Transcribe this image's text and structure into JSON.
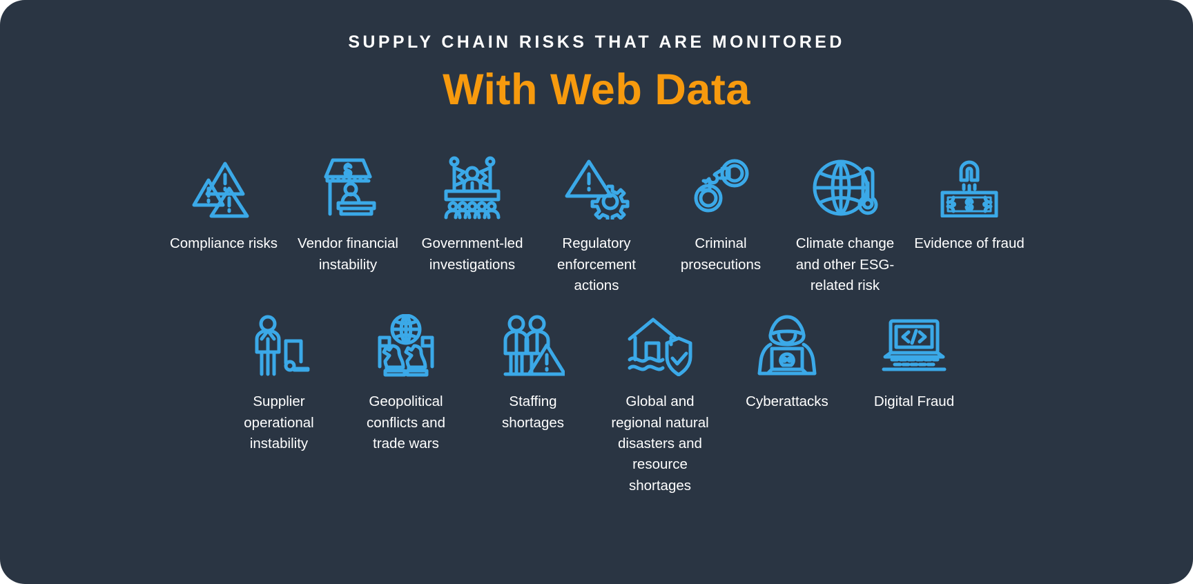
{
  "theme": {
    "background": "#2a3543",
    "page_background": "#ffffff",
    "accent_orange": "#f79a0e",
    "icon_blue": "#3ba9e8",
    "text_white": "#ffffff"
  },
  "header": {
    "eyebrow": "SUPPLY CHAIN RISKS THAT ARE MONITORED",
    "headline": "With Web Data"
  },
  "rows": [
    {
      "items": [
        {
          "label": "Compliance risks",
          "icon": "warning-triangles-icon"
        },
        {
          "label": "Vendor financial\ninstability",
          "icon": "storefront-dollar-icon"
        },
        {
          "label": "Government-led\ninvestigations",
          "icon": "press-podium-audience-icon"
        },
        {
          "label": "Regulatory\nenforcement\nactions",
          "icon": "warning-gear-icon"
        },
        {
          "label": "Criminal\nprosecutions",
          "icon": "handcuffs-icon"
        },
        {
          "label": "Climate change\nand other ESG-\nrelated risk",
          "icon": "globe-thermometer-icon"
        },
        {
          "label": "Evidence of fraud",
          "icon": "magnet-banknote-icon"
        }
      ]
    },
    {
      "items": [
        {
          "label": "Supplier\noperational\ninstability",
          "icon": "person-declining-chart-icon"
        },
        {
          "label": "Geopolitical\nconflicts and\ntrade wars",
          "icon": "globe-chess-flags-icon"
        },
        {
          "label": "Staffing\nshortages",
          "icon": "two-people-warning-icon"
        },
        {
          "label": "Global and\nregional natural\ndisasters and\nresource\nshortages",
          "icon": "flooded-house-shield-icon"
        },
        {
          "label": "Cyberattacks",
          "icon": "hooded-hacker-laptop-skull-icon"
        },
        {
          "label": "Digital Fraud",
          "icon": "laptop-code-icon"
        }
      ]
    }
  ]
}
